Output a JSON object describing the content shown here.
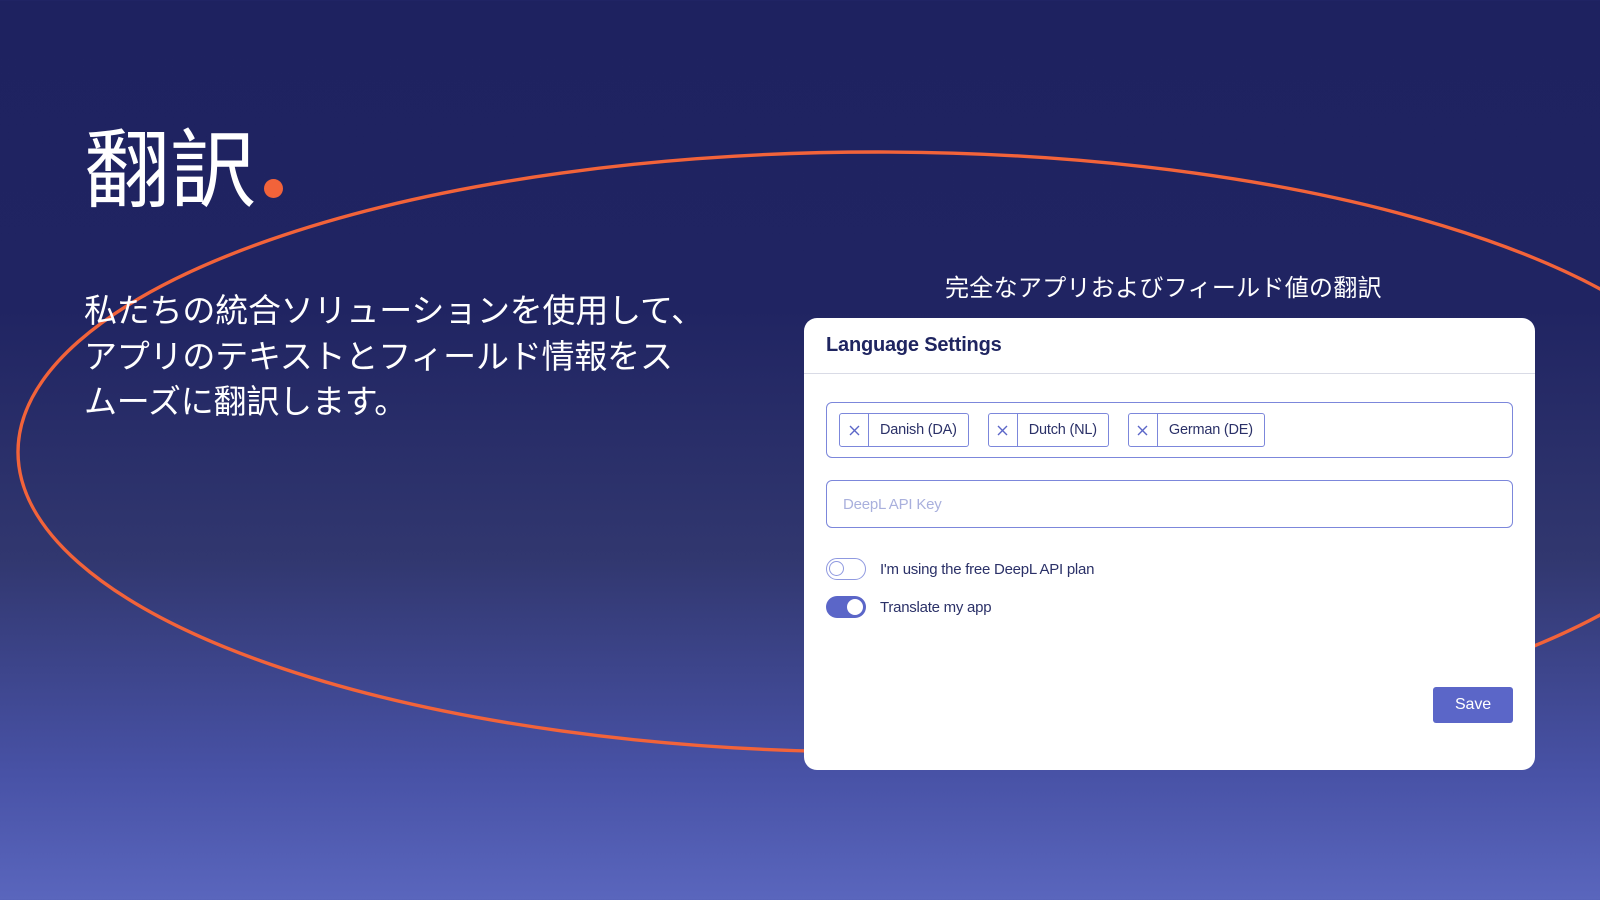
{
  "hero": {
    "title": "翻訳",
    "dot": "orange-dot",
    "body": "私たちの統合ソリューションを使用して、アプリのテキストとフィールド情報をスムーズに翻訳します。"
  },
  "caption": "完全なアプリおよびフィールド値の翻訳",
  "card": {
    "title": "Language Settings",
    "languages": [
      {
        "label": "Danish (DA)",
        "remove_icon": "close-icon"
      },
      {
        "label": "Dutch (NL)",
        "remove_icon": "close-icon"
      },
      {
        "label": "German (DE)",
        "remove_icon": "close-icon"
      }
    ],
    "api_key": {
      "placeholder": "DeepL API Key",
      "value": ""
    },
    "toggles": [
      {
        "label": "I'm using the free DeepL API plan",
        "state": "off"
      },
      {
        "label": "Translate my app",
        "state": "on"
      }
    ],
    "save_label": "Save"
  },
  "colors": {
    "background_top": "#1e2260",
    "background_bottom": "#5a66bd",
    "accent_orange": "#f2633a",
    "accent_blue": "#5b66c8",
    "card_background": "#ffffff",
    "field_border": "#7c87db",
    "title_navy": "#1f2560"
  }
}
